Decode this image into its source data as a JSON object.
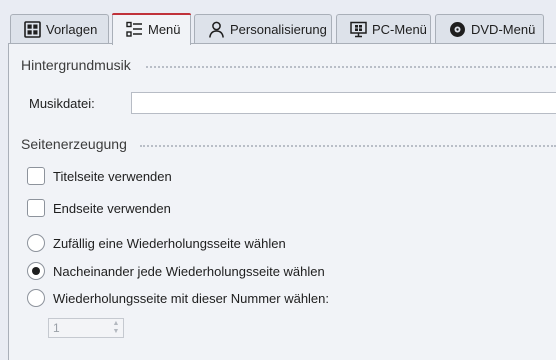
{
  "tabs": [
    {
      "label": "Vorlagen",
      "icon": "grid-icon",
      "active": false
    },
    {
      "label": "Menü",
      "icon": "menu-list-icon",
      "active": true
    },
    {
      "label": "Personalisierung",
      "icon": "person-icon",
      "active": false
    },
    {
      "label": "PC-Menü",
      "icon": "monitor-windows-icon",
      "active": false
    },
    {
      "label": "DVD-Menü",
      "icon": "disc-icon",
      "active": false
    }
  ],
  "music": {
    "section_title": "Hintergrundmusik",
    "file_label": "Musikdatei:",
    "file_value": ""
  },
  "pages": {
    "section_title": "Seitenerzeugung",
    "title_page_label": "Titelseite verwenden",
    "title_page_checked": false,
    "end_page_label": "Endseite verwenden",
    "end_page_checked": false,
    "random_label": "Zufällig eine Wiederholungsseite wählen",
    "sequential_label": "Nacheinander jede Wiederholungsseite wählen",
    "number_label": "Wiederholungsseite mit dieser Nummer wählen:",
    "selected_option": "sequential",
    "number_value": "1"
  },
  "colors": {
    "active_tab_accent": "#c0323a",
    "panel_background": "#f1f3f7"
  }
}
